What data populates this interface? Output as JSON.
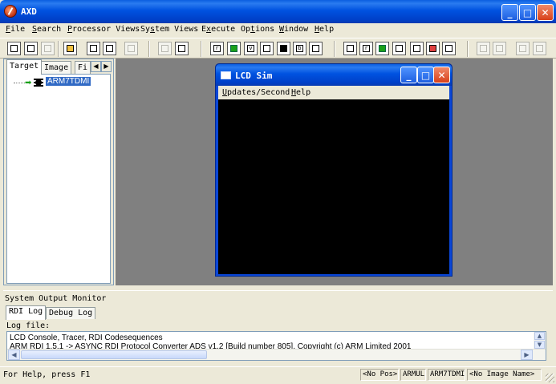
{
  "window": {
    "title": "AXD"
  },
  "menubar": {
    "items": [
      {
        "key": "F",
        "rest": "ile"
      },
      {
        "key": "S",
        "rest": "earch"
      },
      {
        "key": "P",
        "rest": "rocessor Views"
      },
      {
        "key": "",
        "pre": "Sy",
        "keymid": "s",
        "rest": "tem Views"
      },
      {
        "key": "",
        "pre": "E",
        "keymid": "x",
        "rest": "ecute"
      },
      {
        "key": "",
        "pre": "Op",
        "keymid": "t",
        "rest": "ions"
      },
      {
        "key": "W",
        "rest": "indow"
      },
      {
        "key": "H",
        "rest": "elp"
      }
    ]
  },
  "left_panel": {
    "tabs": [
      "Target",
      "Image",
      "Fi"
    ],
    "tree": {
      "root_label": "ARM7TDMI"
    }
  },
  "lcd_window": {
    "title": "LCD Sim",
    "menu": [
      {
        "key": "U",
        "rest": "pdates/Second"
      },
      {
        "key": "H",
        "rest": "elp"
      }
    ]
  },
  "output": {
    "title": "System Output Monitor",
    "tabs": [
      "RDI Log",
      "Debug Log"
    ],
    "log_label": "Log file:",
    "lines": [
      "LCD Console, Tracer, RDI Codesequences",
      "ARM RDI 1.5.1 -> ASYNC RDI Protocol Converter ADS v1.2 [Build number 805], Copyright (c) ARM Limited 2001"
    ]
  },
  "statusbar": {
    "help_text": "For Help, press F1",
    "panes": [
      "<No Pos>",
      "ARMUL",
      "ARM7TDMI",
      "<No Image Name>"
    ]
  },
  "colors": {
    "xp_blue": "#0a46d6",
    "selection": "#316ac5",
    "mdi_bg": "#808080",
    "face": "#ece9d8"
  }
}
